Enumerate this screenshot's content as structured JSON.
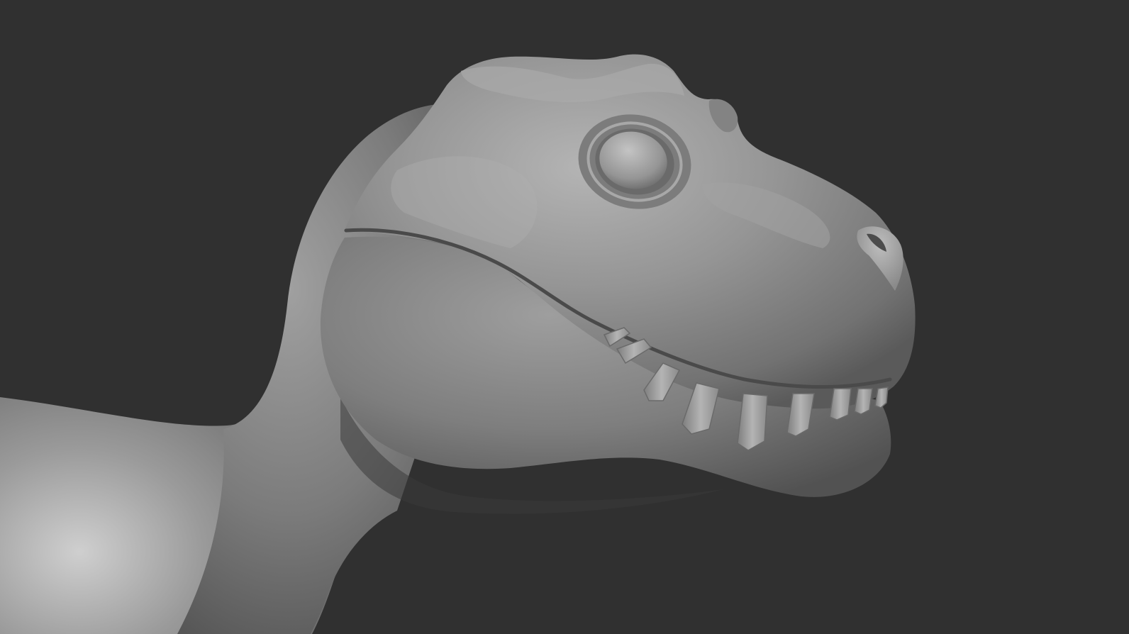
{
  "scene": {
    "subject": "dinosaur-sculpt",
    "background_color": "#303030",
    "clay_color": "#8e8e8e",
    "clay_highlight": "#c8c8c8",
    "clay_shadow": "#3e3e3e",
    "tooth_color": "#a7a7a7"
  }
}
